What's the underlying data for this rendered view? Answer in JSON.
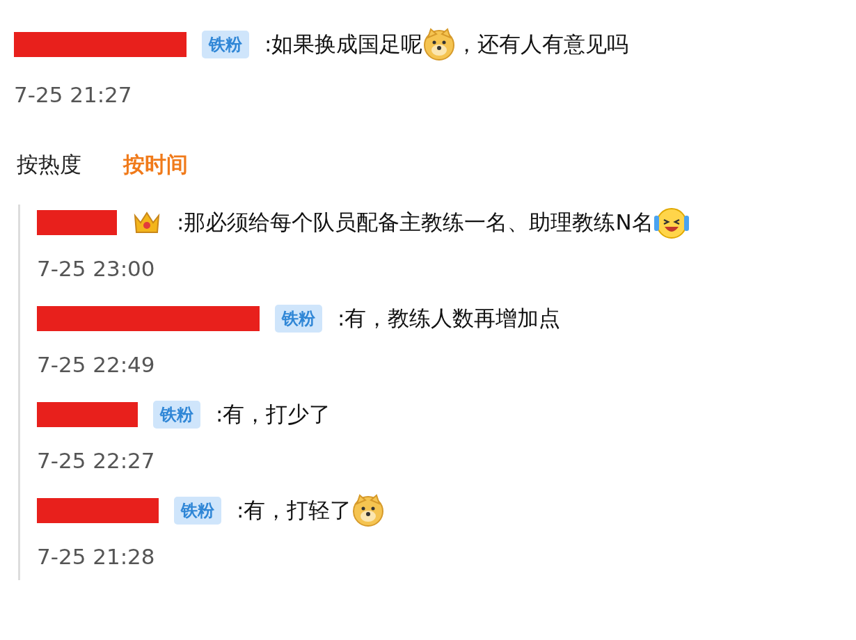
{
  "post": {
    "user": {
      "redacted": true
    },
    "badge": {
      "kind": "fan",
      "label": "铁粉"
    },
    "content": [
      {
        "kind": "text",
        "text": ":如果换成国足呢"
      },
      {
        "kind": "dog-emoji"
      },
      {
        "kind": "text",
        "text": "，还有人有意见吗"
      }
    ],
    "time": "7-25 21:27"
  },
  "sort_tabs": [
    {
      "label": "按热度",
      "selected": false
    },
    {
      "label": "按时间",
      "selected": true
    }
  ],
  "replies": [
    {
      "user": {
        "redacted": true
      },
      "badge": {
        "kind": "crown"
      },
      "content": [
        {
          "kind": "text",
          "text": ":那必须给每个队员配备主教练一名、助理教练N名"
        },
        {
          "kind": "laughing-emoji"
        }
      ],
      "time": "7-25 23:00"
    },
    {
      "user": {
        "redacted": true
      },
      "badge": {
        "kind": "fan",
        "label": "铁粉"
      },
      "content": [
        {
          "kind": "text",
          "text": ":有，教练人数再增加点"
        }
      ],
      "time": "7-25 22:49"
    },
    {
      "user": {
        "redacted": true
      },
      "badge": {
        "kind": "fan",
        "label": "铁粉"
      },
      "content": [
        {
          "kind": "text",
          "text": ":有，打少了"
        }
      ],
      "time": "7-25 22:27"
    },
    {
      "user": {
        "redacted": true
      },
      "badge": {
        "kind": "fan",
        "label": "铁粉"
      },
      "content": [
        {
          "kind": "text",
          "text": ":有，打轻了"
        },
        {
          "kind": "dog-emoji"
        }
      ],
      "time": "7-25 21:28"
    }
  ]
}
